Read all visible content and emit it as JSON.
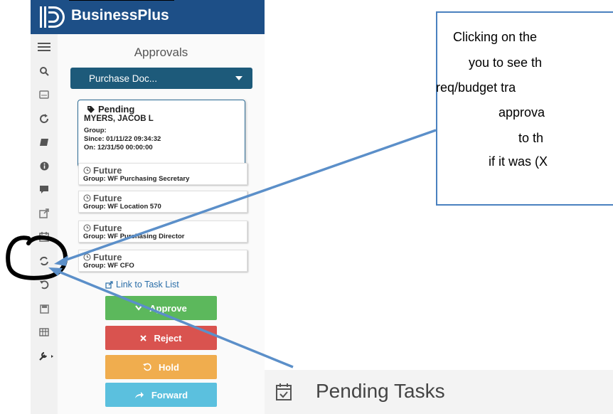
{
  "header": {
    "brand": "BusinessPlus"
  },
  "sidebar": {
    "icons": [
      "menu-icon",
      "search-icon",
      "keyboard-icon",
      "refresh-icon",
      "book-icon",
      "info-icon",
      "comment-icon",
      "external-link-icon",
      "calendar-check-icon",
      "sync-icon",
      "undo-icon",
      "save-icon",
      "table-icon",
      "wrench-icon"
    ]
  },
  "panel": {
    "title": "Approvals",
    "dropdown": "Purchase Doc...",
    "pending": {
      "status": "Pending",
      "name": "MYERS, JACOB L",
      "group": "Group:",
      "since": "Since: 01/11/22 09:34:32",
      "on": "On: 12/31/50 00:00:00"
    },
    "future": [
      {
        "status": "Future",
        "group": "Group: WF Purchasing Secretary"
      },
      {
        "status": "Future",
        "group": "Group: WF Location 570"
      },
      {
        "status": "Future",
        "group": "Group: WF Purchasing Director"
      },
      {
        "status": "Future",
        "group": "Group: WF CFO"
      }
    ],
    "task_link": "Link to Task List",
    "buttons": {
      "approve": "Approve",
      "reject": "Reject",
      "hold": "Hold",
      "forward": "Forward"
    }
  },
  "callout": {
    "lines": [
      "Clicking on the",
      "you to see th",
      "req/budget tra",
      "approva",
      "to th",
      "if it was (X"
    ]
  },
  "pending_tasks": {
    "label": "Pending Tasks"
  },
  "colors": {
    "header": "#1d4f87",
    "dropdown": "#1d5a7a",
    "approve": "#5cb85c",
    "reject": "#d9534f",
    "hold": "#f0ad4e",
    "forward": "#5bc0de",
    "callout_border": "#4a81bf",
    "arrow": "#5b8fc9"
  }
}
